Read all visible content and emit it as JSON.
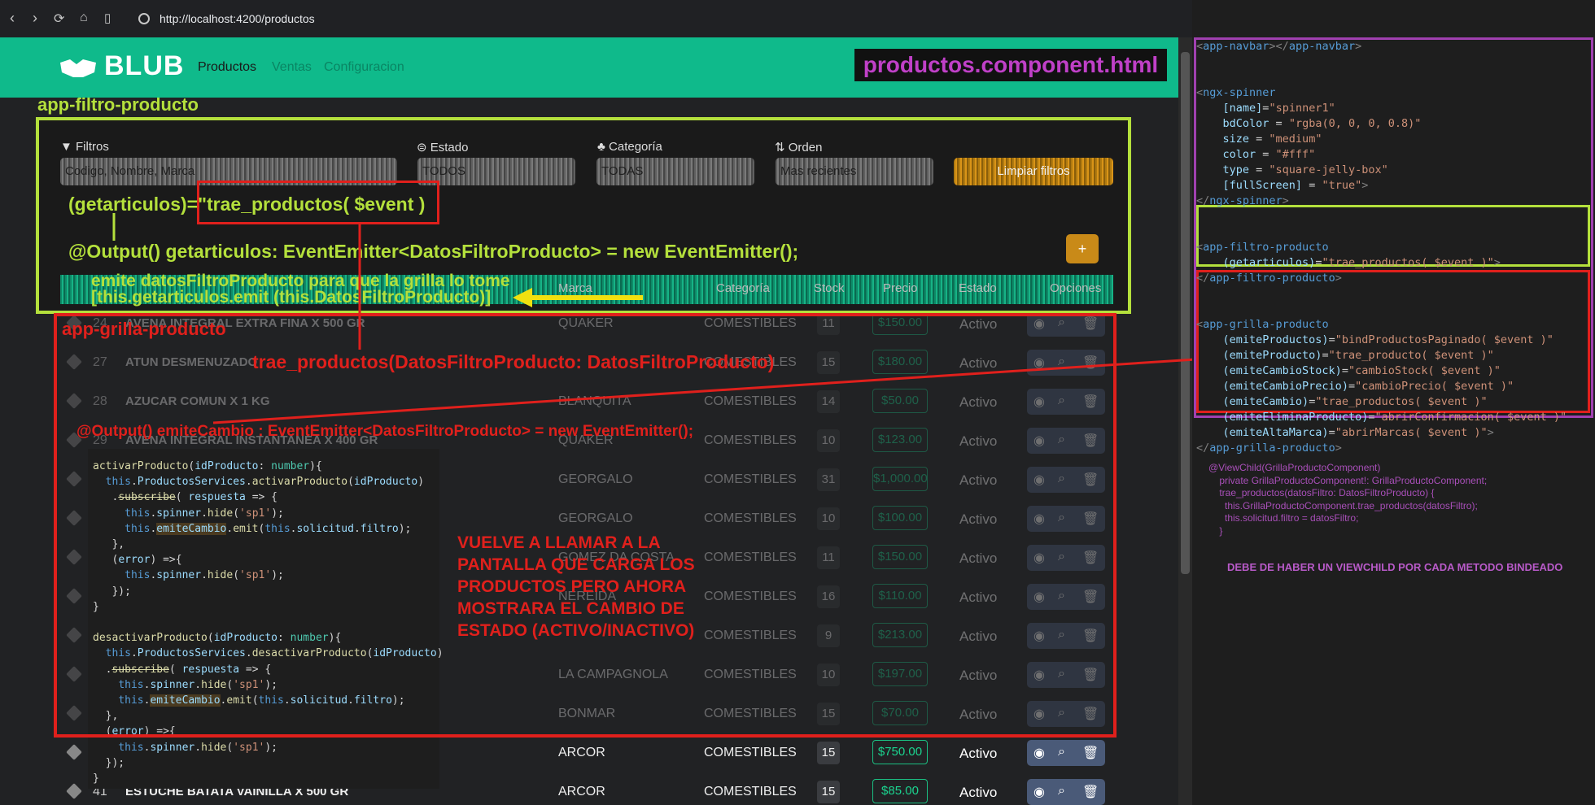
{
  "browser": {
    "url": "http://localhost:4200/productos"
  },
  "navbar": {
    "brand": "BLUB",
    "links": [
      "Productos",
      "Ventas",
      "Configuracion"
    ]
  },
  "component_title": "productos.component.html",
  "filters": {
    "labels": [
      "Filtros",
      "Estado",
      "Categoría",
      "Orden"
    ],
    "inputs": [
      "Codigo, Nombre, Marca",
      "TODOS",
      "TODAS",
      "Mas recientes"
    ],
    "clear_button": "Limpiar filtros",
    "add_button": "+"
  },
  "table": {
    "headers": [
      "Marca",
      "Categoría",
      "Stock",
      "Precio",
      "Estado",
      "Opciones"
    ],
    "rows": [
      {
        "id": "24",
        "name": "AVENA INTEGRAL EXTRA FINA X 500 GR",
        "marca": "QUAKER",
        "cat": "COMESTIBLES",
        "stock": "11",
        "precio": "$150.00",
        "estado": "Activo"
      },
      {
        "id": "27",
        "name": "ATUN DESMENUZADO",
        "marca": "",
        "cat": "COMESTIBLES",
        "stock": "15",
        "precio": "$180.00",
        "estado": "Activo"
      },
      {
        "id": "28",
        "name": "AZUCAR COMUN X 1 KG",
        "marca": "BLANQUITA",
        "cat": "COMESTIBLES",
        "stock": "14",
        "precio": "$50.00",
        "estado": "Activo"
      },
      {
        "id": "29",
        "name": "AVENA INTEGRAL INSTANTANEA X 400 GR",
        "marca": "QUAKER",
        "cat": "COMESTIBLES",
        "stock": "10",
        "precio": "$123.00",
        "estado": "Activo"
      },
      {
        "id": "",
        "name": "",
        "marca": "GEORGALO",
        "cat": "COMESTIBLES",
        "stock": "31",
        "precio": "$1,000.00",
        "estado": "Activo"
      },
      {
        "id": "",
        "name": "",
        "marca": "GEORGALO",
        "cat": "COMESTIBLES",
        "stock": "10",
        "precio": "$100.00",
        "estado": "Activo"
      },
      {
        "id": "",
        "name": "",
        "marca": "GOMEZ DA COSTA",
        "cat": "COMESTIBLES",
        "stock": "11",
        "precio": "$150.00",
        "estado": "Activo"
      },
      {
        "id": "",
        "name": "",
        "marca": "NEREIDA",
        "cat": "COMESTIBLES",
        "stock": "16",
        "precio": "$110.00",
        "estado": "Activo"
      },
      {
        "id": "",
        "name": "",
        "marca": "",
        "cat": "COMESTIBLES",
        "stock": "9",
        "precio": "$213.00",
        "estado": "Activo"
      },
      {
        "id": "",
        "name": "",
        "marca": "LA CAMPAGNOLA",
        "cat": "COMESTIBLES",
        "stock": "10",
        "precio": "$197.00",
        "estado": "Activo"
      },
      {
        "id": "",
        "name": "",
        "marca": "BONMAR",
        "cat": "COMESTIBLES",
        "stock": "15",
        "precio": "$70.00",
        "estado": "Activo"
      },
      {
        "id": "",
        "name": "",
        "marca": "ARCOR",
        "cat": "COMESTIBLES",
        "stock": "15",
        "precio": "$750.00",
        "estado": "Activo"
      },
      {
        "id": "41",
        "name": "ESTUCHE BATATA VAINILLA X 500 GR",
        "marca": "ARCOR",
        "cat": "COMESTIBLES",
        "stock": "15",
        "precio": "$85.00",
        "estado": "Activo"
      }
    ]
  },
  "annotations": {
    "filtro_label": "app-filtro-producto",
    "grilla_label": "app-grilla-producto",
    "getarticulos": "(getarticulos)=\"trae_productos( $event )",
    "output_get": "@Output() getarticulos: EventEmitter<DatosFiltroProducto> = new EventEmitter();",
    "emite1": "emite datosFiltroProducto para que la grilla lo tome",
    "emite2": "[this.getarticulos.emit (this.DatosFiltroProducto)]",
    "trae": "trae_productos(DatosFiltroProducto: DatosFiltroProducto)",
    "output_cambio": "@Output() emiteCambio : EventEmitter<DatosFiltroProducto> = new EventEmitter();",
    "vuelve": "VUELVE A LLAMAR A LA\nPANTALLA QUE CARGA LOS\nPRODUCTOS PERO AHORA\nMOSTRARA EL CAMBIO DE\nESTADO (ACTIVO/INACTIVO)",
    "viewchild": "@ViewChild(GrillaProductoComponent)\n    private GrillaProductoComponent!: GrillaProductoComponent;\n    trae_productos(datosFiltro: DatosFiltroProducto) {\n      this.GrillaProductoComponent.trae_productos(datosFiltro);\n      this.solicitud.filtro = datosFiltro;\n    }",
    "debe": "DEBE DE HABER UN VIEWCHILD POR CADA METODO BINDEADO"
  },
  "colors": {
    "navbar": "#0fba8b",
    "filtro_box": "#b4e03c",
    "grilla_box": "#e0201c",
    "purple": "#a040b0"
  }
}
